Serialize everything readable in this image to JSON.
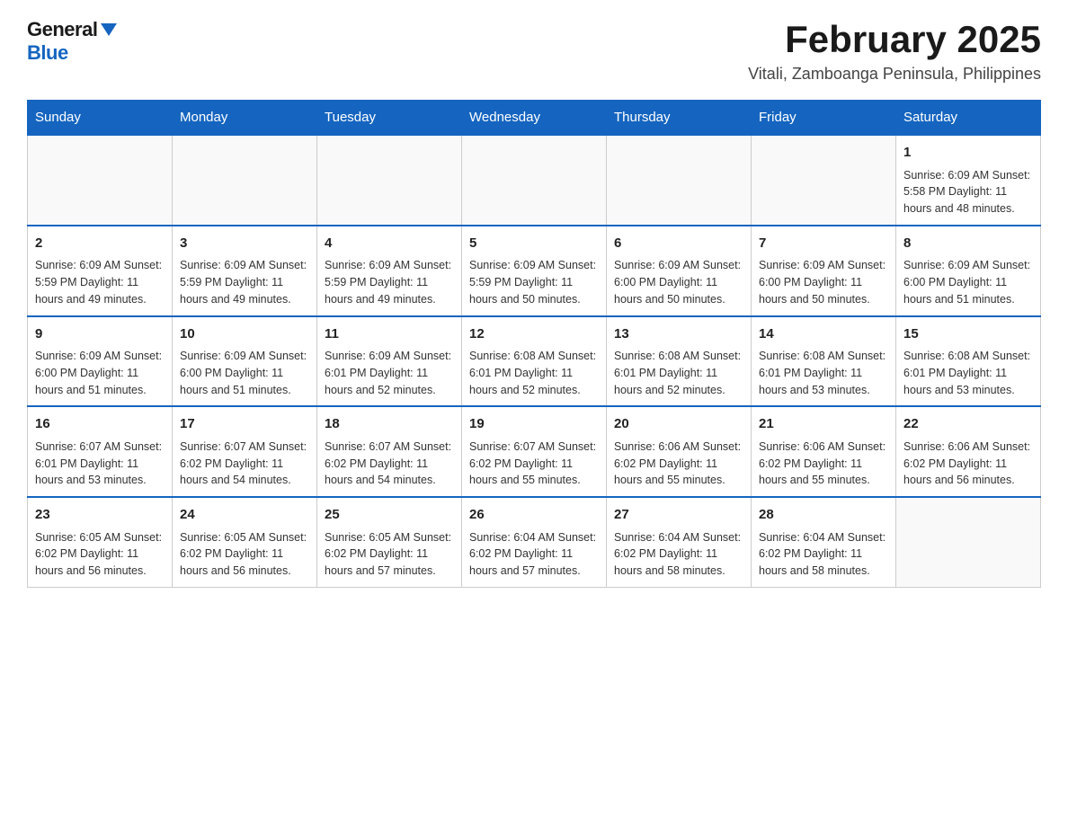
{
  "header": {
    "logo_general": "General",
    "logo_blue": "Blue",
    "month_title": "February 2025",
    "location": "Vitali, Zamboanga Peninsula, Philippines"
  },
  "days_of_week": [
    "Sunday",
    "Monday",
    "Tuesday",
    "Wednesday",
    "Thursday",
    "Friday",
    "Saturday"
  ],
  "weeks": [
    [
      {
        "day": "",
        "info": ""
      },
      {
        "day": "",
        "info": ""
      },
      {
        "day": "",
        "info": ""
      },
      {
        "day": "",
        "info": ""
      },
      {
        "day": "",
        "info": ""
      },
      {
        "day": "",
        "info": ""
      },
      {
        "day": "1",
        "info": "Sunrise: 6:09 AM\nSunset: 5:58 PM\nDaylight: 11 hours and 48 minutes."
      }
    ],
    [
      {
        "day": "2",
        "info": "Sunrise: 6:09 AM\nSunset: 5:59 PM\nDaylight: 11 hours and 49 minutes."
      },
      {
        "day": "3",
        "info": "Sunrise: 6:09 AM\nSunset: 5:59 PM\nDaylight: 11 hours and 49 minutes."
      },
      {
        "day": "4",
        "info": "Sunrise: 6:09 AM\nSunset: 5:59 PM\nDaylight: 11 hours and 49 minutes."
      },
      {
        "day": "5",
        "info": "Sunrise: 6:09 AM\nSunset: 5:59 PM\nDaylight: 11 hours and 50 minutes."
      },
      {
        "day": "6",
        "info": "Sunrise: 6:09 AM\nSunset: 6:00 PM\nDaylight: 11 hours and 50 minutes."
      },
      {
        "day": "7",
        "info": "Sunrise: 6:09 AM\nSunset: 6:00 PM\nDaylight: 11 hours and 50 minutes."
      },
      {
        "day": "8",
        "info": "Sunrise: 6:09 AM\nSunset: 6:00 PM\nDaylight: 11 hours and 51 minutes."
      }
    ],
    [
      {
        "day": "9",
        "info": "Sunrise: 6:09 AM\nSunset: 6:00 PM\nDaylight: 11 hours and 51 minutes."
      },
      {
        "day": "10",
        "info": "Sunrise: 6:09 AM\nSunset: 6:00 PM\nDaylight: 11 hours and 51 minutes."
      },
      {
        "day": "11",
        "info": "Sunrise: 6:09 AM\nSunset: 6:01 PM\nDaylight: 11 hours and 52 minutes."
      },
      {
        "day": "12",
        "info": "Sunrise: 6:08 AM\nSunset: 6:01 PM\nDaylight: 11 hours and 52 minutes."
      },
      {
        "day": "13",
        "info": "Sunrise: 6:08 AM\nSunset: 6:01 PM\nDaylight: 11 hours and 52 minutes."
      },
      {
        "day": "14",
        "info": "Sunrise: 6:08 AM\nSunset: 6:01 PM\nDaylight: 11 hours and 53 minutes."
      },
      {
        "day": "15",
        "info": "Sunrise: 6:08 AM\nSunset: 6:01 PM\nDaylight: 11 hours and 53 minutes."
      }
    ],
    [
      {
        "day": "16",
        "info": "Sunrise: 6:07 AM\nSunset: 6:01 PM\nDaylight: 11 hours and 53 minutes."
      },
      {
        "day": "17",
        "info": "Sunrise: 6:07 AM\nSunset: 6:02 PM\nDaylight: 11 hours and 54 minutes."
      },
      {
        "day": "18",
        "info": "Sunrise: 6:07 AM\nSunset: 6:02 PM\nDaylight: 11 hours and 54 minutes."
      },
      {
        "day": "19",
        "info": "Sunrise: 6:07 AM\nSunset: 6:02 PM\nDaylight: 11 hours and 55 minutes."
      },
      {
        "day": "20",
        "info": "Sunrise: 6:06 AM\nSunset: 6:02 PM\nDaylight: 11 hours and 55 minutes."
      },
      {
        "day": "21",
        "info": "Sunrise: 6:06 AM\nSunset: 6:02 PM\nDaylight: 11 hours and 55 minutes."
      },
      {
        "day": "22",
        "info": "Sunrise: 6:06 AM\nSunset: 6:02 PM\nDaylight: 11 hours and 56 minutes."
      }
    ],
    [
      {
        "day": "23",
        "info": "Sunrise: 6:05 AM\nSunset: 6:02 PM\nDaylight: 11 hours and 56 minutes."
      },
      {
        "day": "24",
        "info": "Sunrise: 6:05 AM\nSunset: 6:02 PM\nDaylight: 11 hours and 56 minutes."
      },
      {
        "day": "25",
        "info": "Sunrise: 6:05 AM\nSunset: 6:02 PM\nDaylight: 11 hours and 57 minutes."
      },
      {
        "day": "26",
        "info": "Sunrise: 6:04 AM\nSunset: 6:02 PM\nDaylight: 11 hours and 57 minutes."
      },
      {
        "day": "27",
        "info": "Sunrise: 6:04 AM\nSunset: 6:02 PM\nDaylight: 11 hours and 58 minutes."
      },
      {
        "day": "28",
        "info": "Sunrise: 6:04 AM\nSunset: 6:02 PM\nDaylight: 11 hours and 58 minutes."
      },
      {
        "day": "",
        "info": ""
      }
    ]
  ]
}
